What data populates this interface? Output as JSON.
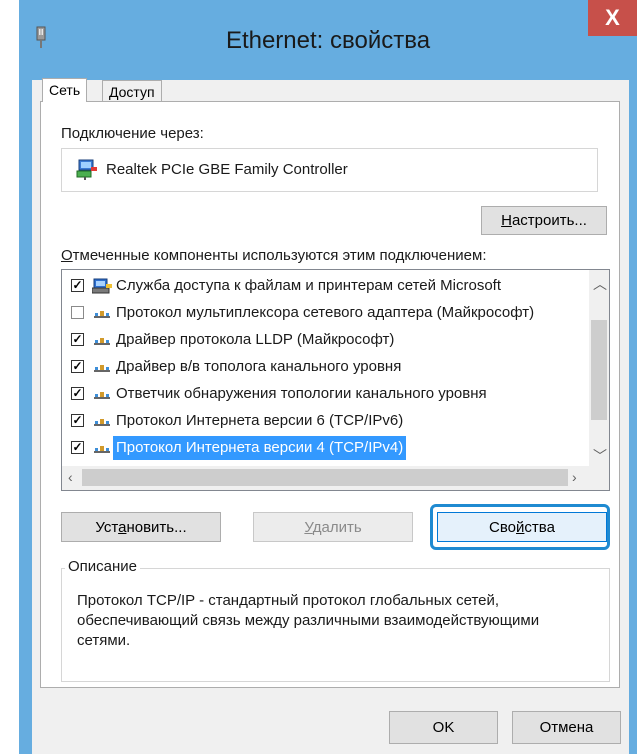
{
  "window": {
    "title": "Ethernet: свойства",
    "close_glyph": "X",
    "accent_color": "#66ade0"
  },
  "tabs": [
    {
      "label": "Сеть",
      "active": true
    },
    {
      "label": "Доступ",
      "active": false
    }
  ],
  "connect_via": {
    "label": "Подключение через:",
    "adapter_name": "Realtek PCIe GBE Family Controller",
    "icon": "network-adapter-icon"
  },
  "configure_button": {
    "pre": "",
    "accel": "Н",
    "post": "астроить..."
  },
  "components_label": {
    "accel": "О",
    "post": "тмеченные компоненты используются этим подключением:"
  },
  "components": [
    {
      "checked": true,
      "icon": "file-printer-sharing-icon",
      "label": "Служба доступа к файлам и принтерам сетей Microsoft"
    },
    {
      "checked": false,
      "icon": "protocol-icon",
      "label": "Протокол мультиплексора сетевого адаптера (Майкрософт)"
    },
    {
      "checked": true,
      "icon": "protocol-icon",
      "label": "Драйвер протокола LLDP (Майкрософт)"
    },
    {
      "checked": true,
      "icon": "protocol-icon",
      "label": "Драйвер в/в тополога канального уровня"
    },
    {
      "checked": true,
      "icon": "protocol-icon",
      "label": "Ответчик обнаружения топологии канального уровня"
    },
    {
      "checked": true,
      "icon": "protocol-icon",
      "label": "Протокол Интернета версии 6 (TCP/IPv6)"
    },
    {
      "checked": true,
      "icon": "protocol-icon",
      "label": "Протокол Интернета версии 4 (TCP/IPv4)",
      "selected": true
    }
  ],
  "buttons": {
    "install": {
      "pre": "Уст",
      "accel": "а",
      "post": "новить..."
    },
    "remove": {
      "pre": "",
      "accel": "У",
      "post": "далить",
      "disabled": true
    },
    "properties": {
      "pre": "Сво",
      "accel": "й",
      "post": "ства"
    }
  },
  "description": {
    "legend": "Описание",
    "text": "Протокол TCP/IP - стандартный протокол глобальных сетей, обеспечивающий связь между различными взаимодействующими сетями."
  },
  "footer": {
    "ok": "OK",
    "cancel": "Отмена"
  },
  "checkmark_glyph": "✓"
}
